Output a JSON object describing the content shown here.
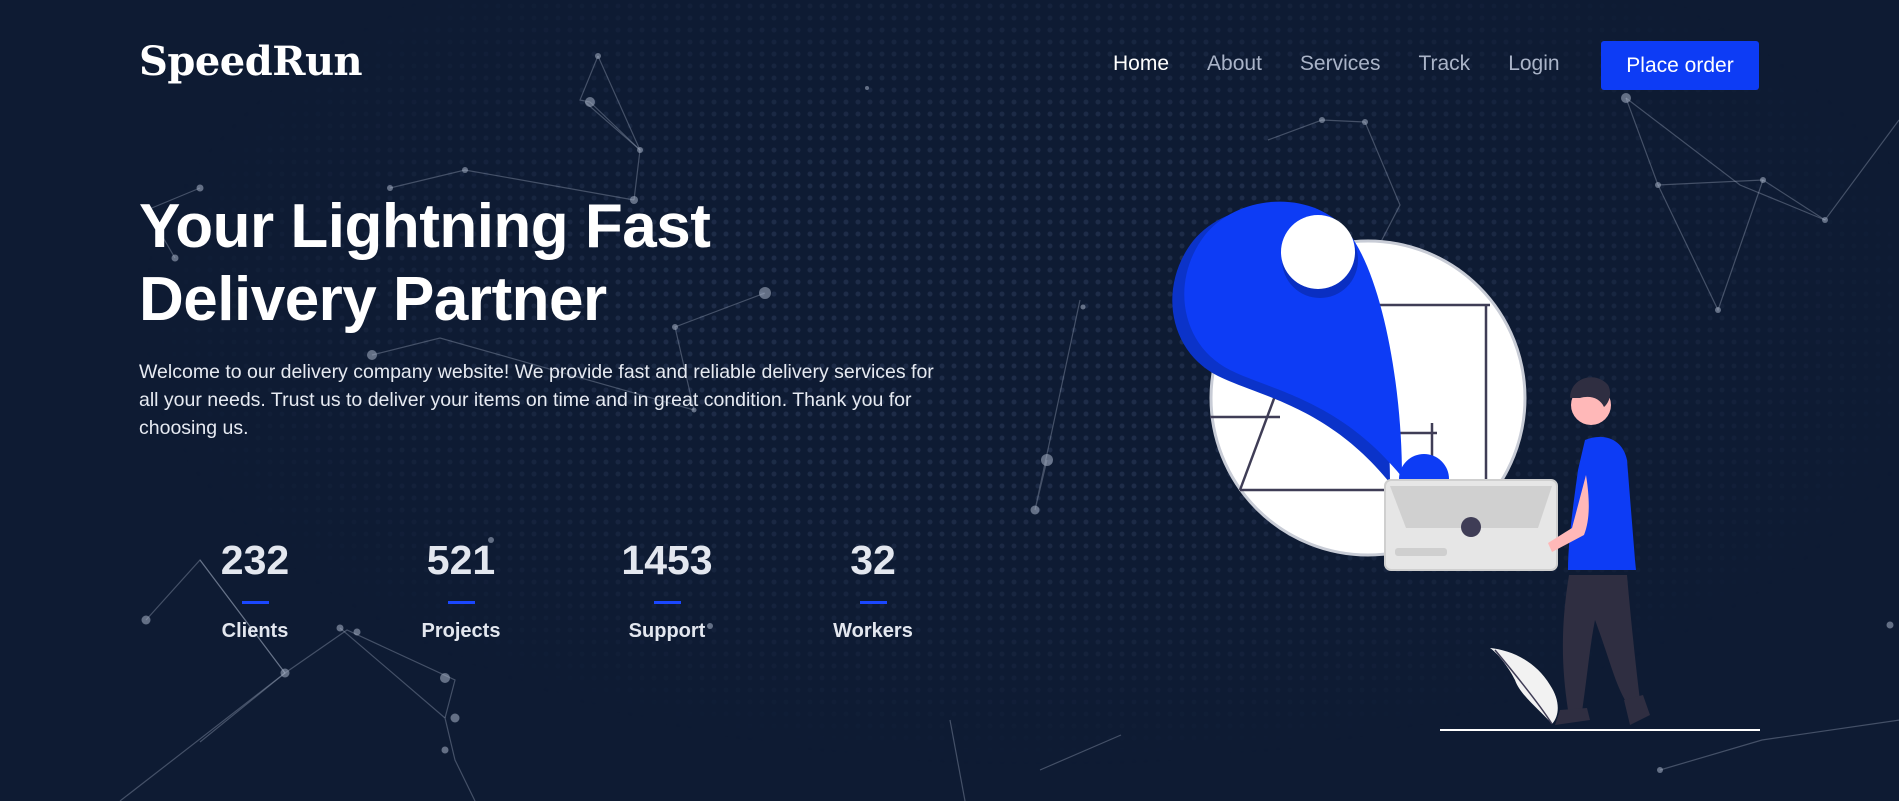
{
  "brand": {
    "name": "SpeedRun"
  },
  "nav": {
    "items": [
      {
        "label": "Home",
        "active": true
      },
      {
        "label": "About",
        "active": false
      },
      {
        "label": "Services",
        "active": false
      },
      {
        "label": "Track",
        "active": false
      },
      {
        "label": "Login",
        "active": false
      }
    ],
    "cta_label": "Place order"
  },
  "hero": {
    "title_line1": "Your Lightning Fast",
    "title_line2": "Delivery Partner",
    "description": "Welcome to our delivery company website! We provide fast and reliable delivery services for all your needs. Trust us to deliver your items on time and in great condition. Thank you for choosing us."
  },
  "stats": [
    {
      "value": "232",
      "label": "Clients"
    },
    {
      "value": "521",
      "label": "Projects"
    },
    {
      "value": "1453",
      "label": "Support"
    },
    {
      "value": "32",
      "label": "Workers"
    }
  ],
  "colors": {
    "background": "#0e1b33",
    "accent": "#0d3cf5",
    "text": "#ffffff",
    "muted": "#aab4c8"
  }
}
